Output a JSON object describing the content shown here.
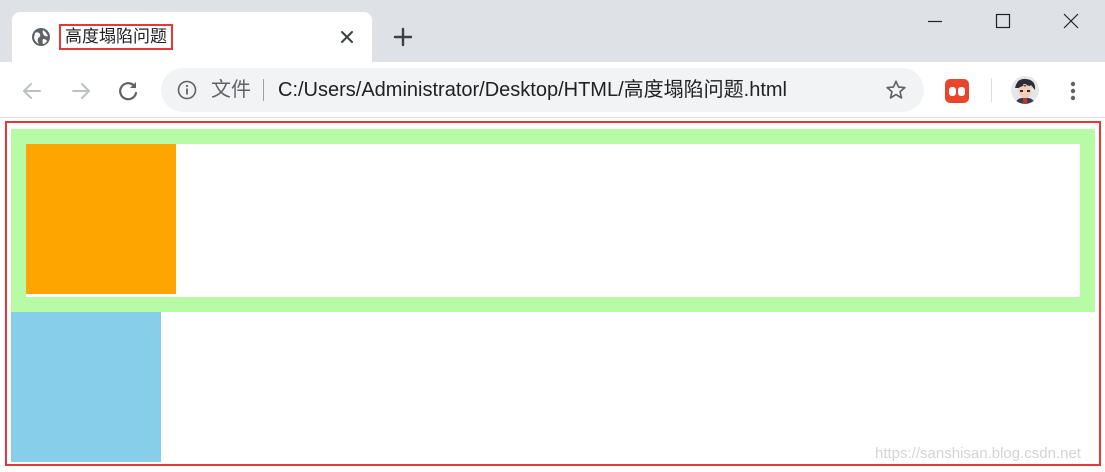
{
  "tab": {
    "title": "高度塌陷问题"
  },
  "toolbar": {
    "security_label": "文件",
    "url": "C:/Users/Administrator/Desktop/HTML/高度塌陷问题.html"
  },
  "icons": [
    "globe-icon",
    "close-icon",
    "plus-icon",
    "minimize-icon",
    "maximize-icon",
    "window-close-icon",
    "back-arrow-icon",
    "forward-arrow-icon",
    "reload-icon",
    "info-icon",
    "star-icon",
    "extension-icon",
    "avatar",
    "more-vert-icon"
  ],
  "colors": {
    "tabstrip_bg": "#dee1e6",
    "highlight_border": "#e53935",
    "parent_border": "#b7fba5",
    "float_child": "#ffa500",
    "sibling_box": "#87ceeb"
  },
  "page": {
    "watermark": "https://sanshisan.blog.csdn.net"
  }
}
